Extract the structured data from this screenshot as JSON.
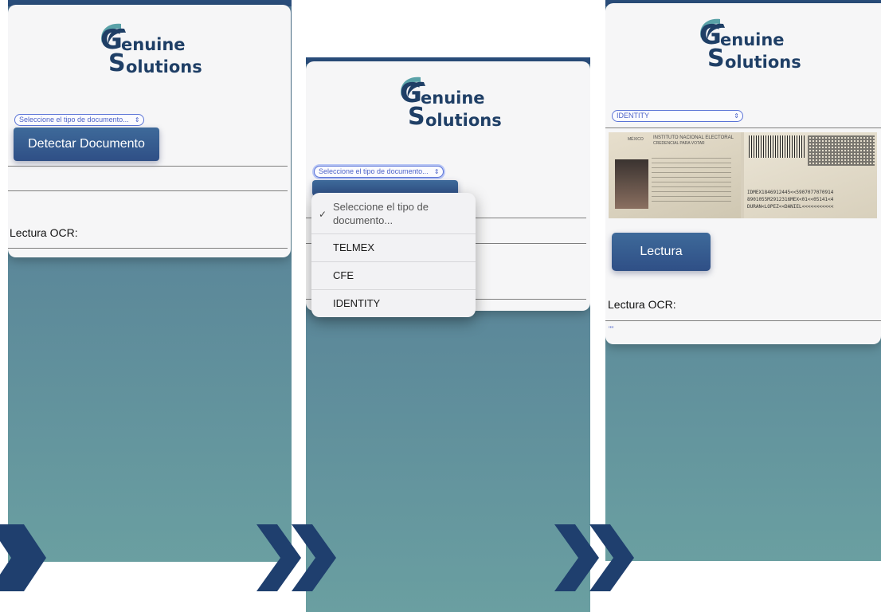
{
  "logo": {
    "line1": "enuine",
    "line2": "olutions",
    "letter1": "G",
    "letter2": "S"
  },
  "screen1": {
    "select_text": "Seleccione el tipo de documento...",
    "button_label": "Detectar Documento",
    "ocr_label": "Lectura OCR:"
  },
  "screen2": {
    "select_text": "Seleccione el tipo de documento...",
    "dropdown": {
      "options": [
        "Seleccione el tipo de documento...",
        "TELMEX",
        "CFE",
        "IDENTITY"
      ],
      "selected_index": 0,
      "checkmark": "✓"
    }
  },
  "screen3": {
    "select_text": "IDENTITY",
    "button_label": "Lectura",
    "ocr_label": "Lectura OCR:",
    "ocr_result": "\"\"",
    "id_card": {
      "country": "MÉXICO",
      "institute": "INSTITUTO NACIONAL ELECTORAL",
      "subtitle": "CREDENCIAL PARA VOTAR",
      "mrz1": "IDMEX1846912445<<5907077070914",
      "mrz2": "8901055M2912316MEX<01<<05141<4",
      "mrz3": "DURAN<LOPEZ<<DANIEL<<<<<<<<<<<"
    }
  },
  "colors": {
    "navy": "#1f3f66",
    "button": "#2f4f86",
    "select_border": "#5a73d6",
    "chevron": "#1f3f6e"
  }
}
